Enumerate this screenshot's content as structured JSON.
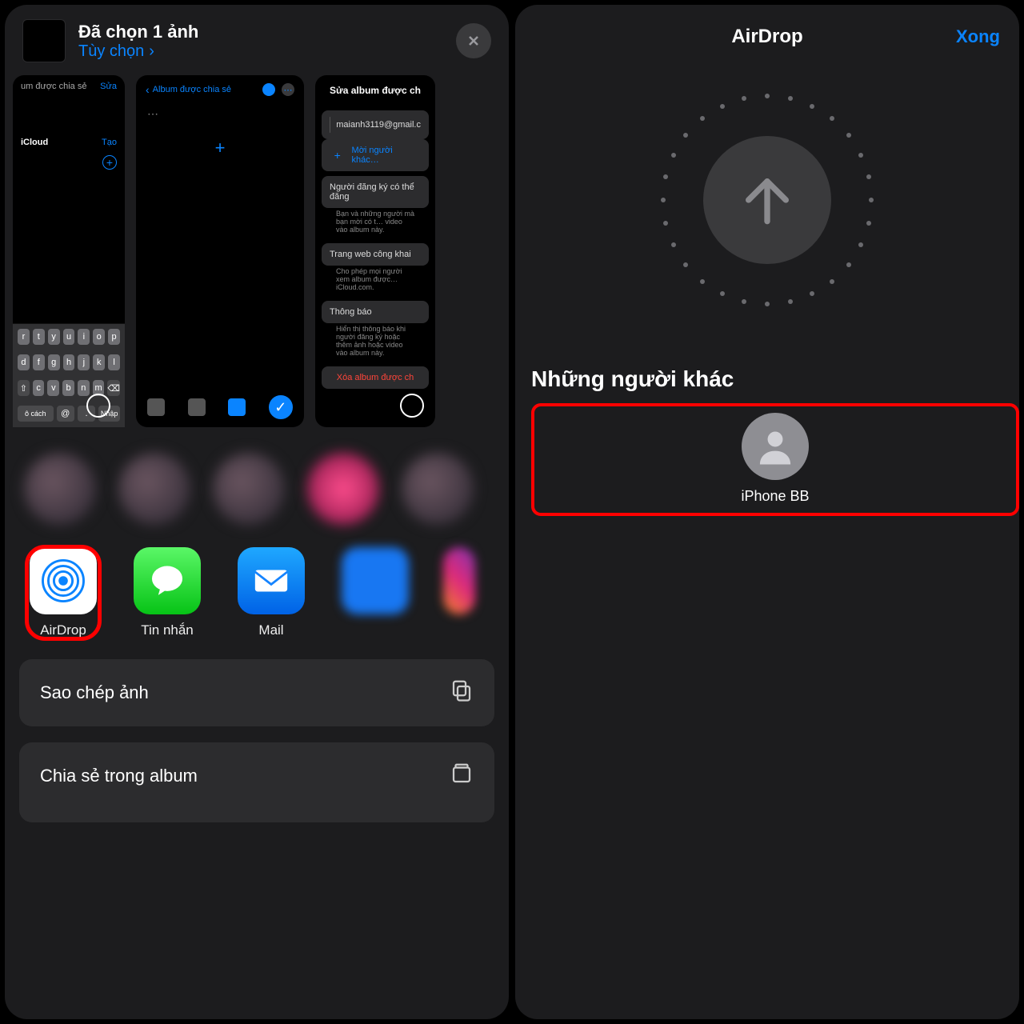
{
  "left": {
    "header": {
      "title": "Đã chọn 1 ảnh",
      "options_link": "Tùy chọn"
    },
    "preview_a": {
      "top_label": "um được chia sẻ",
      "top_action": "Sửa",
      "section_label": "iCloud",
      "section_action": "Tạo"
    },
    "preview_b": {
      "back_label": "Album được chia sẻ"
    },
    "preview_c": {
      "title": "Sửa album được ch",
      "row1_email": "maianh3119@gmail.c",
      "row2_label": "Mời người khác…",
      "row3_title": "Người đăng ký có thể đăng",
      "row3_sub": "Bạn và những người mà bạn mời có t… video vào album này.",
      "row4_title": "Trang web công khai",
      "row4_sub": "Cho phép mọi người xem album được… iCloud.com.",
      "row5_title": "Thông báo",
      "row5_sub": "Hiển thị thông báo khi người đăng ký hoặc thêm ảnh hoặc video vào album này.",
      "row6_danger": "Xóa album được ch"
    },
    "apps": {
      "airdrop": "AirDrop",
      "messages": "Tin nhắn",
      "mail": "Mail"
    },
    "actions": {
      "copy": "Sao chép ảnh",
      "sharealbum": "Chia sẻ trong album"
    },
    "keys": {
      "r1": [
        "r",
        "t",
        "y",
        "u",
        "i",
        "o",
        "p"
      ],
      "r2": [
        "d",
        "f",
        "g",
        "h",
        "j",
        "k",
        "l"
      ],
      "r3": [
        "c",
        "v",
        "b",
        "n",
        "m"
      ],
      "space_left": "ô cách",
      "at": "@",
      "enter": "Nhập"
    }
  },
  "right": {
    "title": "AirDrop",
    "done": "Xong",
    "section": "Những người khác",
    "recipient": "iPhone BB"
  }
}
